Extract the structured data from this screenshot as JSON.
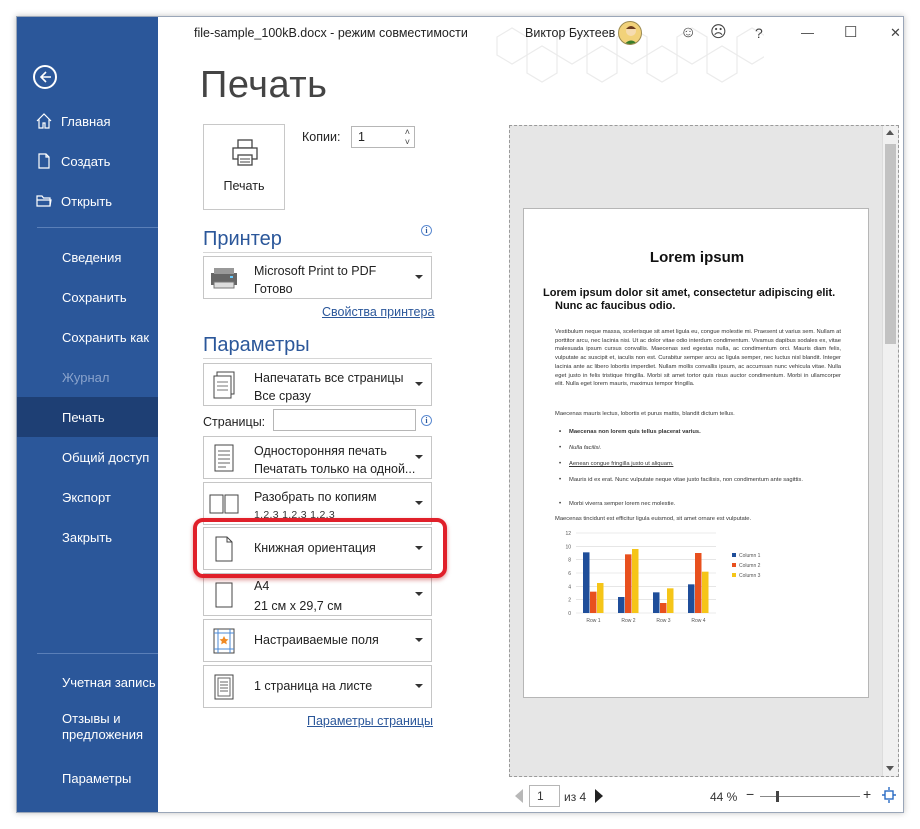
{
  "titlebar": {
    "doc_title": "file-sample_100kB.docx  -  режим совместимости",
    "user_name": "Виктор Бухтеев",
    "icons": [
      "smile-icon",
      "frown-icon",
      "help-icon",
      "minimize-icon",
      "maximize-icon",
      "close-icon"
    ],
    "glyphs": {
      "smile": "☺",
      "frown": "☹",
      "help": "?",
      "minimize": "—",
      "maximize": "☐",
      "close": "✕"
    }
  },
  "sidebar": {
    "color": "#2b579a",
    "items": [
      {
        "label": "Главная",
        "icon": "home-icon"
      },
      {
        "label": "Создать",
        "icon": "new-document-icon"
      },
      {
        "label": "Открыть",
        "icon": "open-folder-icon"
      },
      {
        "label": "Сведения"
      },
      {
        "label": "Сохранить"
      },
      {
        "label": "Сохранить как"
      },
      {
        "label": "Журнал",
        "disabled": true
      },
      {
        "label": "Печать",
        "active": true
      },
      {
        "label": "Общий доступ"
      },
      {
        "label": "Экспорт"
      },
      {
        "label": "Закрыть"
      },
      {
        "label": "Учетная запись"
      },
      {
        "label": "Отзывы и"
      },
      {
        "label": "предложения"
      },
      {
        "label": "Параметры"
      }
    ]
  },
  "print": {
    "page_title": "Печать",
    "print_button": "Печать",
    "copies_label": "Копии:",
    "copies_value": "1"
  },
  "printer": {
    "section_title": "Принтер",
    "name": "Microsoft Print to PDF",
    "status": "Готово",
    "properties_link": "Свойства принтера"
  },
  "settings": {
    "section_title": "Параметры",
    "range": {
      "line1": "Напечатать все страницы",
      "line2": "Все сразу"
    },
    "pages_label": "Страницы:",
    "pages_value": "",
    "sides": {
      "line1": "Односторонняя печать",
      "line2": "Печатать только на одной..."
    },
    "collate": {
      "line1": "Разобрать по копиям",
      "line2": "1,2,3    1,2,3    1,2,3"
    },
    "orientation": "Книжная ориентация",
    "paper": {
      "line1": "A4",
      "line2": "21 см x 29,7 см"
    },
    "margins": "Настраиваемые поля",
    "per_sheet": "1 страница на листе",
    "page_setup_link": "Параметры страницы"
  },
  "preview": {
    "title": "Lorem ipsum",
    "heading_line1": "Lorem ipsum dolor sit amet, consectetur adipiscing elit.",
    "heading_line2": "Nunc ac faucibus odio.",
    "paragraph": "Vestibulum neque massa, scelerisque sit amet ligula eu, congue molestie mi. Praesent ut varius sem. Nullam at porttitor arcu, nec lacinia nisi. Ut ac dolor vitae odio interdum condimentum. Vivamus dapibus sodales ex, vitae malesuada ipsum cursus convallis. Maecenas sed egestas nulla, ac condimentum orci. Mauris diam felis, vulputate ac suscipit et, iaculis non est. Curabitur semper arcu ac ligula semper, nec luctus nisl blandit. Integer lacinia ante ac libero lobortis imperdiet. Nullam mollis convallis ipsum, ac accumsan nunc vehicula vitae. Nulla eget justo in felis tristique fringilla. Morbi sit amet tortor quis risus auctor condimentum. Morbi in ullamcorper elit. Nulla eget lorem mauris, maximus tempor fringilla.",
    "paragraph2": "Maecenas mauris lectus, lobortis et purus mattis, blandit dictum tellus.",
    "list": [
      "Maecenas non lorem quis tellus placerat varius.",
      "Nulla facilisi.",
      "Aenean congue fringilla justo ut aliquam.",
      "Mauris id ex erat. Nunc vulputate neque vitae justo facilisis, non condimentum ante sagittis.",
      "Morbi viverra semper lorem nec molestie."
    ],
    "paragraph3": "Maecenas tincidunt est efficitur ligula euismod, sit amet ornare est vulputate.",
    "page_number": "1",
    "page_of": "из 4",
    "zoom": "44 %"
  },
  "chart_data": {
    "type": "bar",
    "categories": [
      "Row 1",
      "Row 2",
      "Row 3",
      "Row 4"
    ],
    "series": [
      {
        "name": "Column 1",
        "values": [
          9.1,
          2.4,
          3.1,
          4.3
        ],
        "color": "#1f4e9a"
      },
      {
        "name": "Column 2",
        "values": [
          3.2,
          8.8,
          1.5,
          9.0
        ],
        "color": "#e8501e"
      },
      {
        "name": "Column 3",
        "values": [
          4.5,
          9.6,
          3.7,
          6.2
        ],
        "color": "#f5c518"
      }
    ],
    "ylim": [
      0,
      12
    ],
    "yticks": [
      "12",
      "10",
      "8",
      "6",
      "4",
      "2",
      "0"
    ],
    "legend": "right",
    "grid": true
  }
}
